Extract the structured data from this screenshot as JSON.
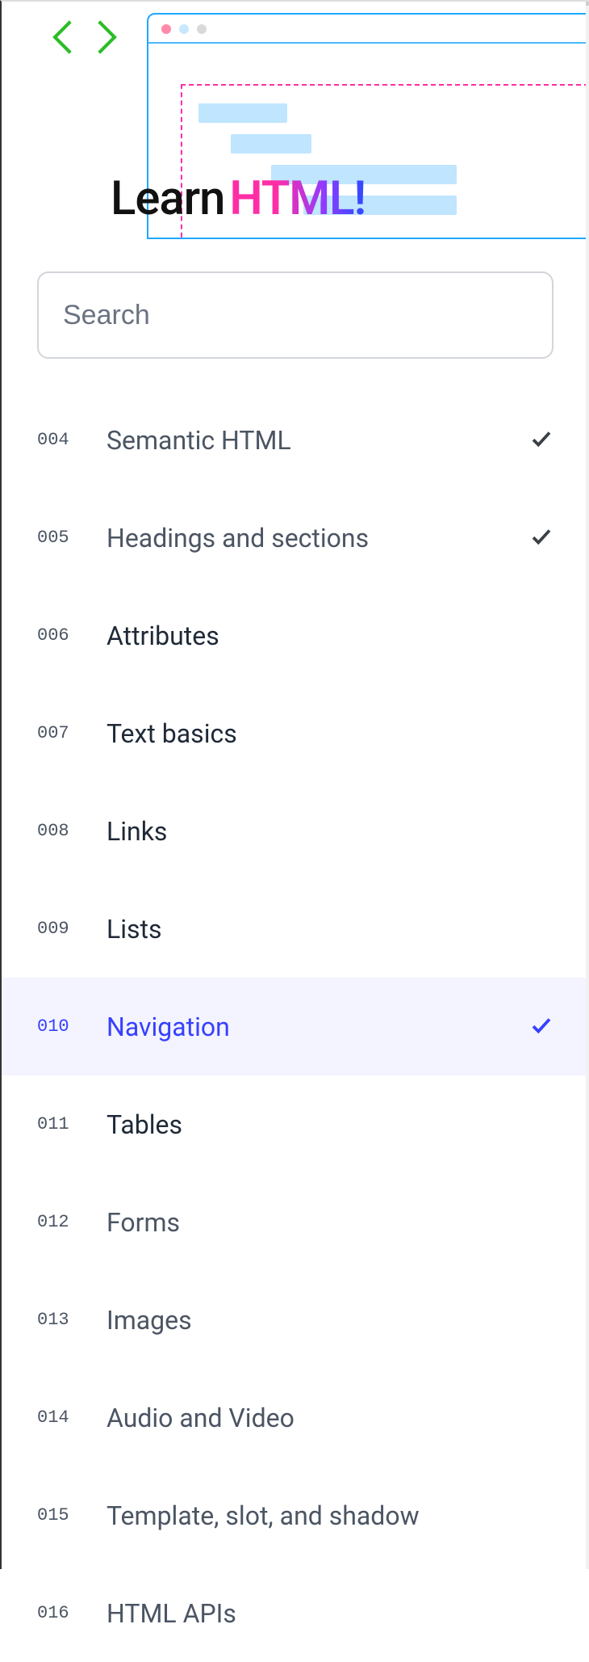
{
  "hero": {
    "title_plain": "Learn",
    "title_accent": "HTML!"
  },
  "search": {
    "placeholder": "Search"
  },
  "items": [
    {
      "num": "004",
      "label": "Semantic HTML",
      "visited": true,
      "active": false,
      "check": true
    },
    {
      "num": "005",
      "label": "Headings and sections",
      "visited": true,
      "active": false,
      "check": true
    },
    {
      "num": "006",
      "label": "Attributes",
      "visited": false,
      "active": false,
      "check": false
    },
    {
      "num": "007",
      "label": "Text basics",
      "visited": false,
      "active": false,
      "check": false
    },
    {
      "num": "008",
      "label": "Links",
      "visited": false,
      "active": false,
      "check": false
    },
    {
      "num": "009",
      "label": "Lists",
      "visited": false,
      "active": false,
      "check": false
    },
    {
      "num": "010",
      "label": "Navigation",
      "visited": false,
      "active": true,
      "check": true
    },
    {
      "num": "011",
      "label": "Tables",
      "visited": false,
      "active": false,
      "check": false
    },
    {
      "num": "012",
      "label": "Forms",
      "visited": true,
      "active": false,
      "check": false
    },
    {
      "num": "013",
      "label": "Images",
      "visited": true,
      "active": false,
      "check": false
    },
    {
      "num": "014",
      "label": "Audio and Video",
      "visited": true,
      "active": false,
      "check": false
    },
    {
      "num": "015",
      "label": "Template, slot, and shadow",
      "visited": true,
      "active": false,
      "check": false
    },
    {
      "num": "016",
      "label": "HTML APIs",
      "visited": true,
      "active": false,
      "check": false
    }
  ]
}
